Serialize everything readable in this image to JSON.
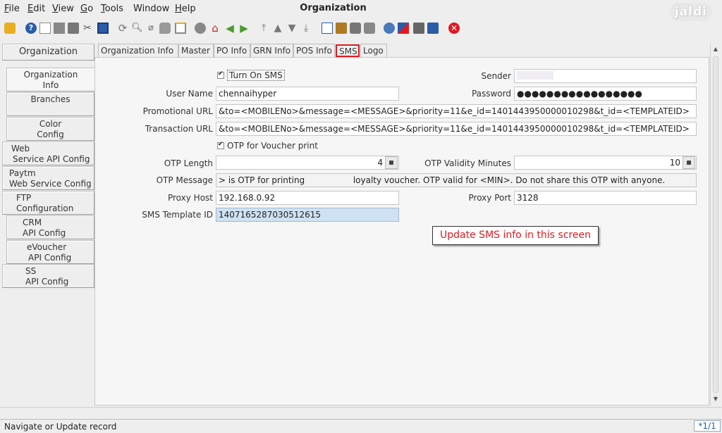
{
  "window": {
    "title": "Organization",
    "logo_text": "jaldi"
  },
  "menu": [
    {
      "mnemonic": "F",
      "rest": "ile"
    },
    {
      "mnemonic": "E",
      "rest": "dit"
    },
    {
      "mnemonic": "V",
      "rest": "iew"
    },
    {
      "mnemonic": "G",
      "rest": "o"
    },
    {
      "mnemonic": "T",
      "rest": "ools"
    },
    {
      "mnemonic": "",
      "rest": "Window"
    },
    {
      "mnemonic": "H",
      "rest": "elp"
    }
  ],
  "toolbar": {
    "icons": [
      "undo-icon",
      "help-icon",
      "new-record-icon",
      "copy-record-icon",
      "delete-icon",
      "delete-selection-icon",
      "save-icon",
      "refresh-icon",
      "find-icon",
      "attachment-icon",
      "chat-icon",
      "multi-row-icon",
      "history-icon",
      "home-icon",
      "back-icon",
      "forward-icon",
      "first-record-icon",
      "previous-record-icon",
      "next-record-icon",
      "last-record-icon",
      "report-icon",
      "archive-icon",
      "print-preview-icon",
      "print-icon",
      "zoom-across-icon",
      "workflow-icon",
      "product-info-icon",
      "end-icon",
      "close-window-icon"
    ],
    "colors": {
      "accent_green": "#4a9a2c",
      "accent_red": "#e0191f",
      "accent_blue": "#2b5ca8"
    }
  },
  "sidebar": {
    "items": [
      {
        "line1": "Organization",
        "line2": ""
      },
      {
        "line1": "Organization",
        "line2": "Info"
      },
      {
        "line1": "Branches",
        "line2": ""
      },
      {
        "line1": "Color",
        "line2": "Config"
      },
      {
        "line1": "Web",
        "line2": "Service API Config"
      },
      {
        "line1": "Paytm",
        "line2": "Web Service Config"
      },
      {
        "line1": "FTP",
        "line2": "Configuration"
      },
      {
        "line1": "CRM",
        "line2": "API Config"
      },
      {
        "line1": "eVoucher",
        "line2": "API Config"
      },
      {
        "line1": "SS",
        "line2": "API Config"
      }
    ]
  },
  "tabs": [
    {
      "label": "Organization Info"
    },
    {
      "label": "Master"
    },
    {
      "label": "PO Info"
    },
    {
      "label": "GRN Info"
    },
    {
      "label": "POS Info"
    },
    {
      "label": "SMS"
    },
    {
      "label": "Logo"
    }
  ],
  "form": {
    "turn_on_sms": {
      "label": "Turn On SMS",
      "checked": true
    },
    "sender": {
      "label": "Sender",
      "value": ""
    },
    "user_name": {
      "label": "User Name",
      "value": "chennaihyper"
    },
    "password": {
      "label": "Password",
      "value": "●●●●●●●●●●●●●●●●●"
    },
    "promotional_url": {
      "label": "Promotional URL",
      "value": "&to=<MOBILENo>&message=<MESSAGE>&priority=11&e_id=1401443950000010298&t_id=<TEMPLATEID>"
    },
    "transaction_url": {
      "label": "Transaction URL",
      "value": "&to=<MOBILENo>&message=<MESSAGE>&priority=11&e_id=1401443950000010298&t_id=<TEMPLATEID>"
    },
    "otp_voucher": {
      "label": "OTP for Voucher print",
      "checked": true
    },
    "otp_length": {
      "label": "OTP Length",
      "value": "4"
    },
    "otp_validity": {
      "label": "OTP Validity Minutes",
      "value": "10"
    },
    "otp_message": {
      "label": "OTP Message",
      "value": "> is OTP for printing                  loyalty voucher. OTP valid for <MIN>. Do not share this OTP with anyone."
    },
    "proxy_host": {
      "label": "Proxy Host",
      "value": "192.168.0.92"
    },
    "proxy_port": {
      "label": "Proxy Port",
      "value": "3128"
    },
    "sms_template_id": {
      "label": "SMS Template ID",
      "value": "1407165287030512615"
    }
  },
  "annotation": {
    "text": "Update SMS info in this screen"
  },
  "status": {
    "text": "Navigate or Update record",
    "record": "*1/1"
  }
}
